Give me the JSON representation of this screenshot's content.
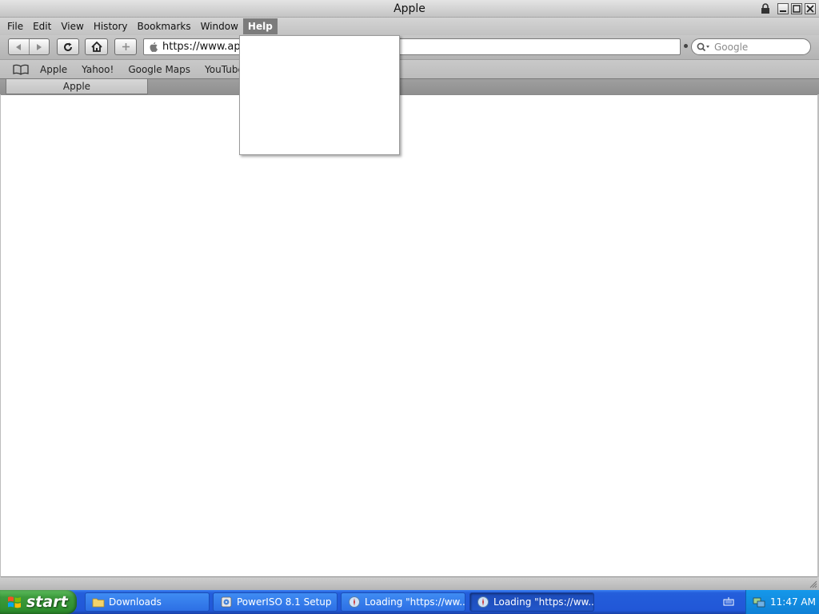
{
  "window": {
    "title": "Apple"
  },
  "menubar": {
    "items": [
      {
        "label": "File"
      },
      {
        "label": "Edit"
      },
      {
        "label": "View"
      },
      {
        "label": "History"
      },
      {
        "label": "Bookmarks"
      },
      {
        "label": "Window"
      },
      {
        "label": "Help",
        "active": true
      }
    ]
  },
  "toolbar": {
    "back_icon": "back-arrow-icon",
    "forward_icon": "forward-arrow-icon",
    "reload_icon": "reload-icon",
    "home_icon": "home-icon",
    "add_icon": "plus-icon",
    "url": "https://www.app",
    "search_placeholder": "Google"
  },
  "bookmarks": {
    "items": [
      {
        "label": "Apple"
      },
      {
        "label": "Yahoo!"
      },
      {
        "label": "Google Maps"
      },
      {
        "label": "YouTube"
      }
    ]
  },
  "tabs": [
    {
      "label": "Apple",
      "active": true
    }
  ],
  "help_menu": {
    "open": true,
    "items": []
  },
  "taskbar": {
    "start_label": "start",
    "tasks": [
      {
        "label": "Downloads",
        "icon": "folder-icon"
      },
      {
        "label": "PowerISO 8.1 Setup",
        "icon": "installer-icon"
      },
      {
        "label": "Loading \"https://ww...",
        "icon": "browser-icon"
      },
      {
        "label": "Loading \"https://ww...",
        "icon": "browser-icon",
        "active": true
      }
    ],
    "clock": "11:47 AM"
  },
  "colors": {
    "taskbar_blue": "#245edb",
    "start_green": "#3c9a3c",
    "tray_blue": "#0f80d6",
    "menu_active": "#7c7c7c"
  }
}
